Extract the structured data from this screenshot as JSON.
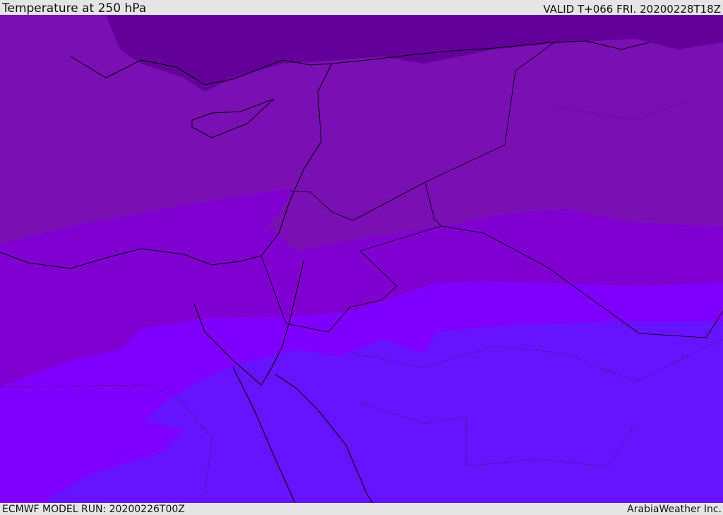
{
  "header": {
    "title": "Temperature at 250 hPa",
    "valid": "VALID T+066 FRI. 20200228T18Z"
  },
  "footer": {
    "model_run": "ECMWF MODEL RUN: 20200226T00Z",
    "brand": "ArabiaWeather Inc."
  },
  "colors": {
    "band1": "#63009a",
    "band2": "#7a10b4",
    "band3": "#8000d2",
    "band4": "#8000ff",
    "band5": "#6614ff"
  }
}
